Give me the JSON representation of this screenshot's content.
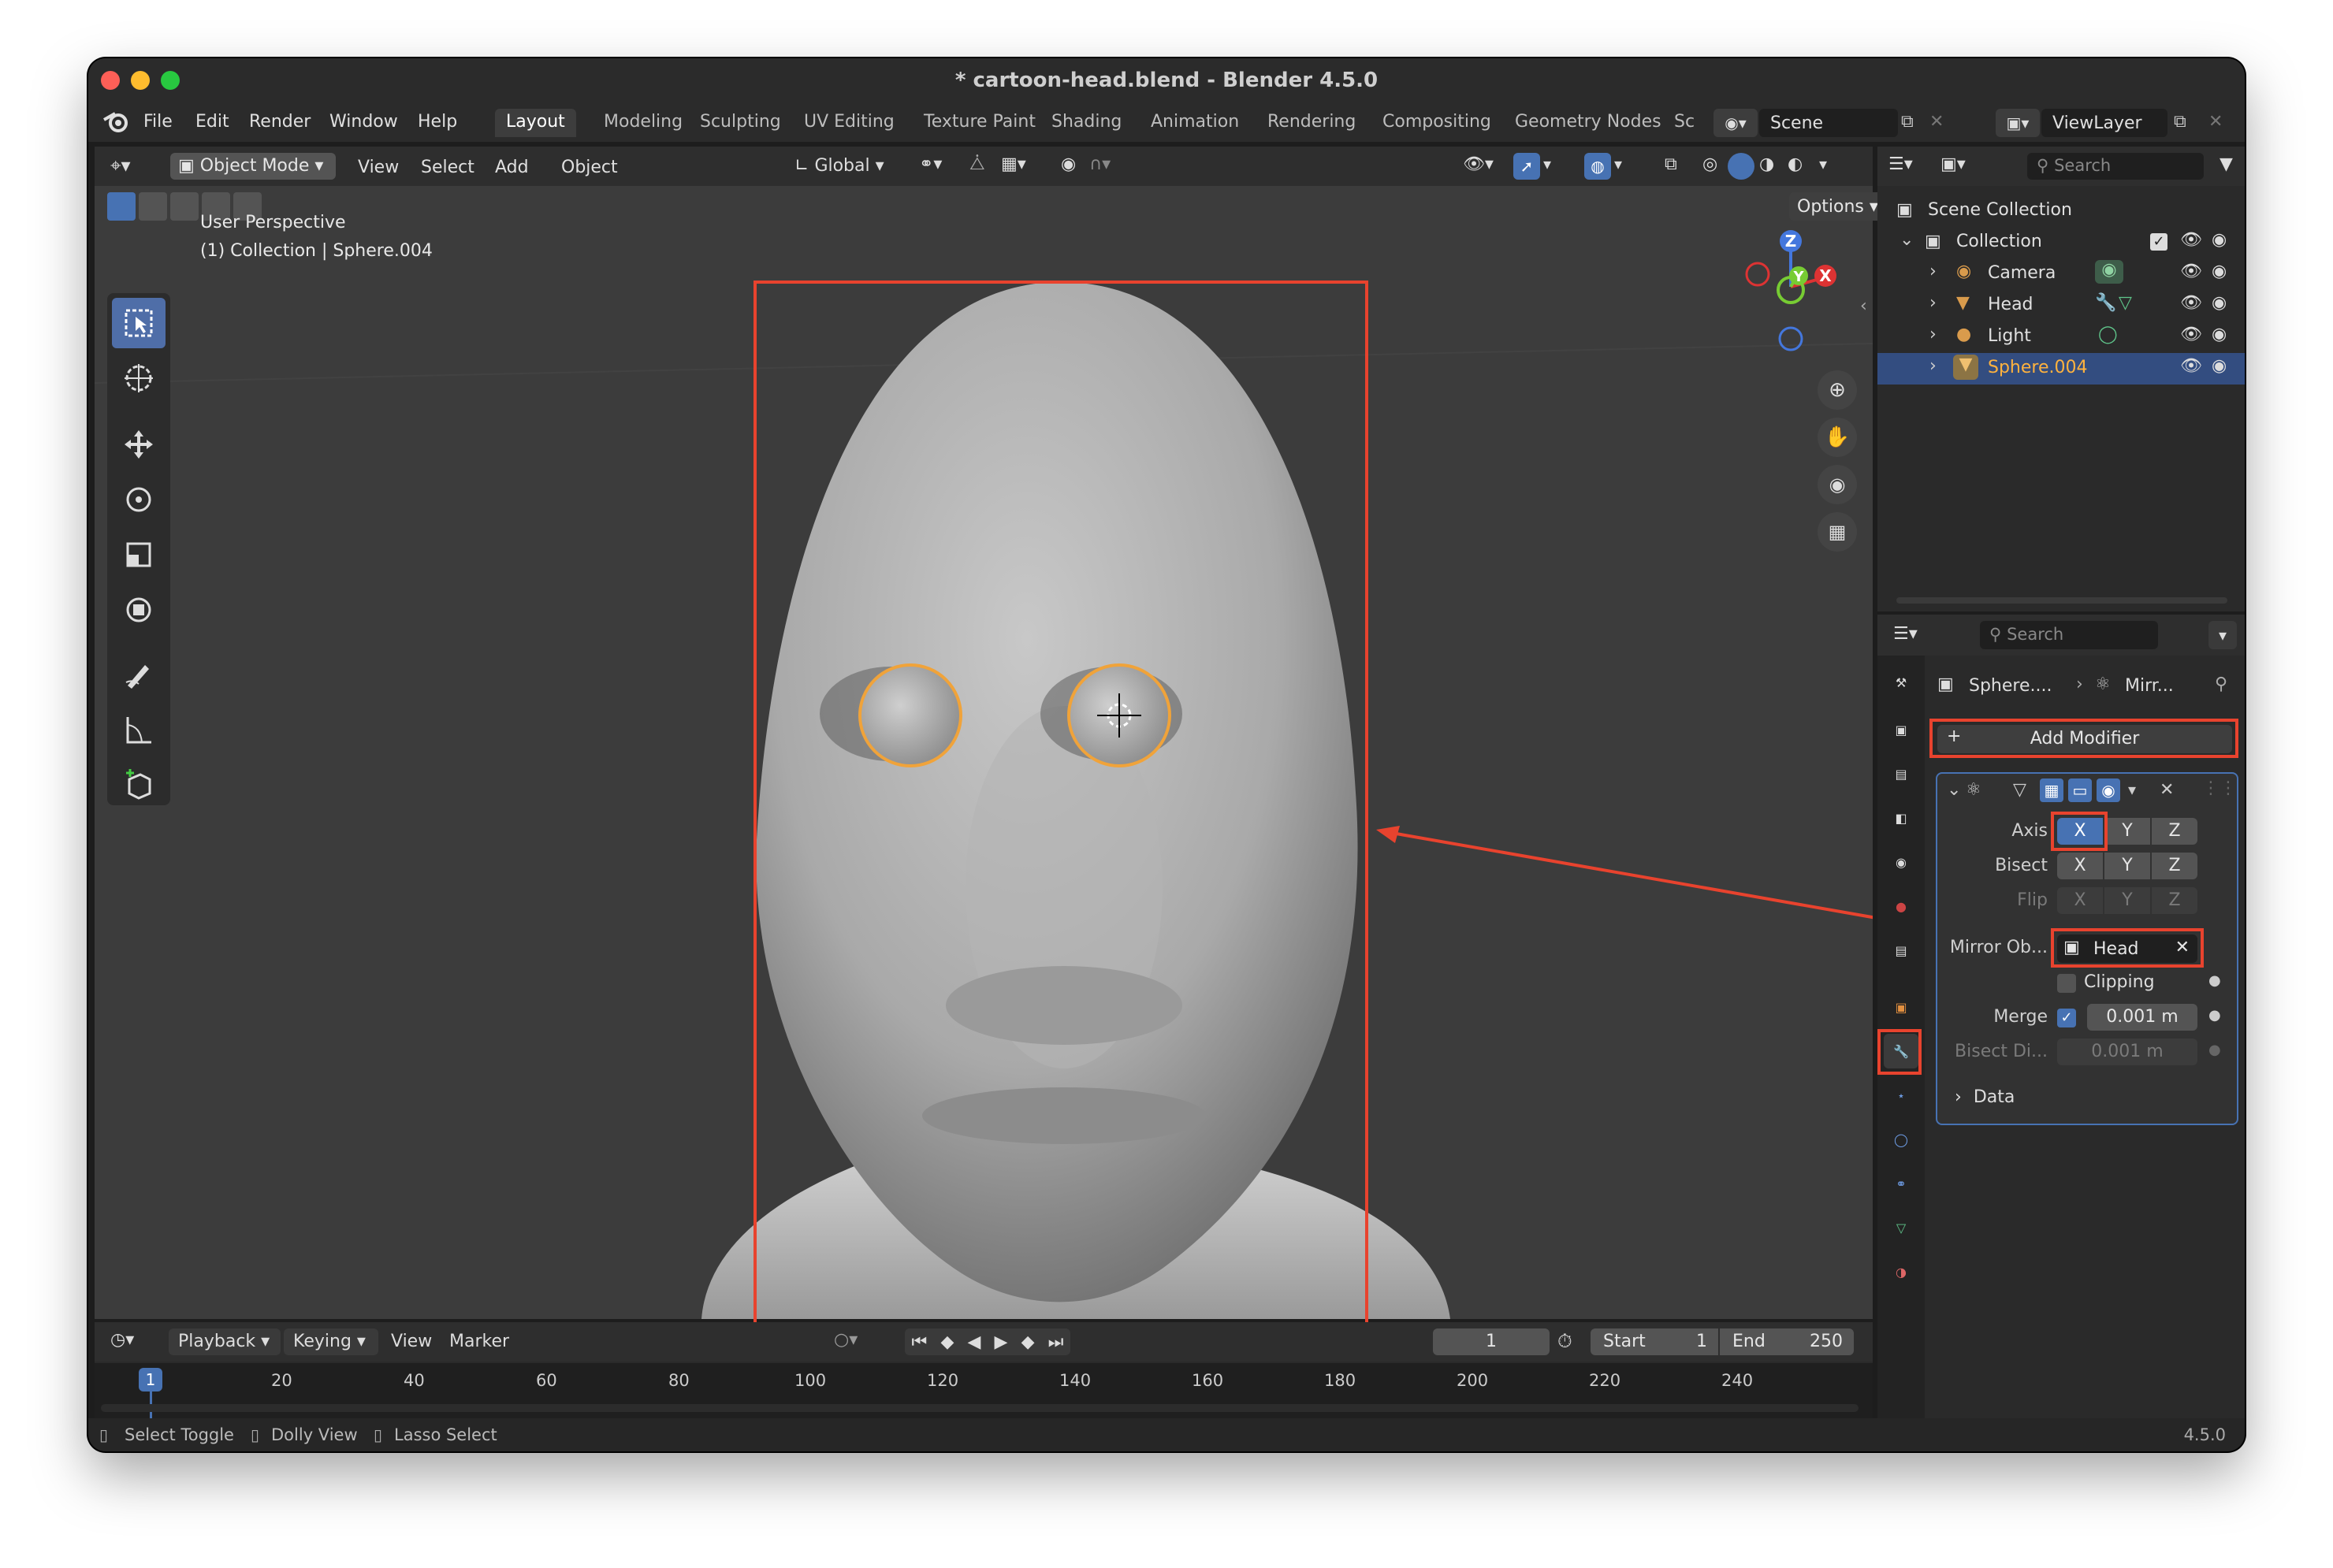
{
  "window": {
    "title": "* cartoon-head.blend - Blender 4.5.0",
    "traffic_colors": [
      "#fe5f57",
      "#febc2e",
      "#28c840"
    ]
  },
  "menu": {
    "items": [
      "File",
      "Edit",
      "Render",
      "Window",
      "Help"
    ],
    "workspaces": [
      "Layout",
      "Modeling",
      "Sculpting",
      "UV Editing",
      "Texture Paint",
      "Shading",
      "Animation",
      "Rendering",
      "Compositing",
      "Geometry Nodes",
      "Sc"
    ],
    "active_workspace": "Layout",
    "scene": "Scene",
    "view_layer": "ViewLayer"
  },
  "viewport": {
    "mode": "Object Mode",
    "menus": [
      "View",
      "Select",
      "Add",
      "Object"
    ],
    "transform_orientation": "Global",
    "options_label": "Options",
    "overlay_line1": "User Perspective",
    "overlay_line2": "(1) Collection | Sphere.004",
    "gizmo": {
      "z": "Z",
      "y": "Y",
      "x": "X"
    },
    "tools": [
      "select-box",
      "cursor",
      "move",
      "rotate",
      "scale",
      "transform",
      "annotate",
      "measure",
      "add-cube"
    ]
  },
  "timeline": {
    "menus": [
      "Playback",
      "Keying",
      "View",
      "Marker"
    ],
    "current_frame": "1",
    "start_label": "Start",
    "start": "1",
    "end_label": "End",
    "end": "250",
    "ruler": [
      "20",
      "40",
      "60",
      "80",
      "100",
      "120",
      "140",
      "160",
      "180",
      "200",
      "220",
      "240"
    ],
    "playhead": "1"
  },
  "status": {
    "hints": [
      "Select Toggle",
      "Dolly View",
      "Lasso Select"
    ],
    "version": "4.5.0"
  },
  "outliner": {
    "search_placeholder": "Search",
    "scene_collection": "Scene Collection",
    "collection": "Collection",
    "objects": [
      {
        "name": "Camera",
        "selected": false
      },
      {
        "name": "Head",
        "selected": false
      },
      {
        "name": "Light",
        "selected": false
      },
      {
        "name": "Sphere.004",
        "selected": true
      }
    ]
  },
  "properties": {
    "search_placeholder": "Search",
    "breadcrumb_object": "Sphere....",
    "breadcrumb_modifier": "Mirr...",
    "add_modifier": "Add Modifier",
    "axis_label": "Axis",
    "bisect_label": "Bisect",
    "flip_label": "Flip",
    "axes": [
      "X",
      "Y",
      "Z"
    ],
    "mirror_object_label": "Mirror Ob...",
    "mirror_object_value": "Head",
    "clipping_label": "Clipping",
    "merge_label": "Merge",
    "merge_value": "0.001 m",
    "bisect_distance_label": "Bisect Di...",
    "bisect_distance_value": "0.001 m",
    "data_label": "Data"
  },
  "colors": {
    "accent": "#4772b3",
    "highlight": "#e8432e",
    "selection_outline": "#f0a33a"
  }
}
